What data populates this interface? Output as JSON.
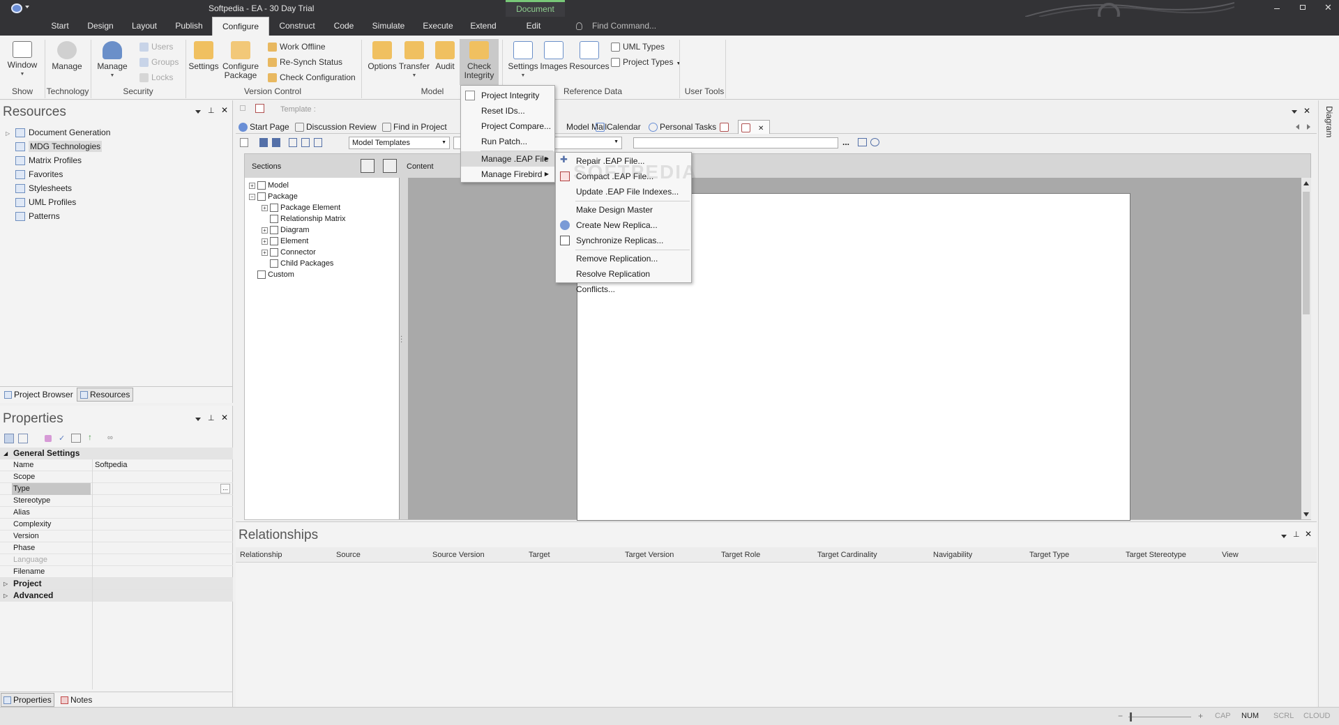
{
  "title": "Softpedia - EA - 30 Day Trial",
  "context_tab": {
    "group": "Document",
    "label": "Edit"
  },
  "tabs": [
    "Start",
    "Design",
    "Layout",
    "Publish",
    "Configure",
    "Construct",
    "Code",
    "Simulate",
    "Execute",
    "Extend"
  ],
  "find_command": "Find Command...",
  "ribbon": {
    "window": "Window",
    "manage_tech": "Manage",
    "manage_sec": "Manage",
    "users": "Users",
    "groups": "Groups",
    "locks": "Locks",
    "settings_vc": "Settings",
    "configure_package": "Configure Package",
    "work_offline": "Work Offline",
    "resynch": "Re-Synch Status",
    "check_config": "Check Configuration",
    "options": "Options",
    "transfer": "Transfer",
    "audit": "Audit",
    "check_integrity": "Check Integrity",
    "settings_ref": "Settings",
    "images": "Images",
    "resources": "Resources",
    "uml_types": "UML Types",
    "project_types": "Project Types",
    "groups_labels": {
      "show": "Show",
      "technology": "Technology",
      "security": "Security",
      "version_control": "Version Control",
      "model": "Model",
      "reference_data": "Reference Data",
      "user_tools": "User Tools"
    }
  },
  "resources_panel": {
    "title": "Resources",
    "items": [
      "Document Generation",
      "MDG Technologies",
      "Matrix Profiles",
      "Favorites",
      "Stylesheets",
      "UML Profiles",
      "Patterns"
    ],
    "tabs": [
      "Project Browser",
      "Resources"
    ]
  },
  "properties_panel": {
    "title": "Properties",
    "section": "General Settings",
    "rows": [
      {
        "k": "Name",
        "v": "Softpedia"
      },
      {
        "k": "Scope",
        "v": ""
      },
      {
        "k": "Type",
        "v": ""
      },
      {
        "k": "Stereotype",
        "v": ""
      },
      {
        "k": "Alias",
        "v": ""
      },
      {
        "k": "Complexity",
        "v": ""
      },
      {
        "k": "Version",
        "v": ""
      },
      {
        "k": "Phase",
        "v": ""
      },
      {
        "k": "Language",
        "v": ""
      },
      {
        "k": "Filename",
        "v": ""
      }
    ],
    "sections_after": [
      "Project",
      "Advanced"
    ],
    "tabs": [
      "Properties",
      "Notes"
    ]
  },
  "document": {
    "template_label": "Template :",
    "tabs": [
      "Start Page",
      "Discussion Review",
      "Find in Project",
      "Model Mail",
      "Calendar",
      "Personal Tasks"
    ],
    "templates_select": "Model Templates",
    "sections_label": "Sections",
    "content_label": "Content",
    "tree": [
      {
        "label": "Model",
        "level": 0,
        "exp": "+"
      },
      {
        "label": "Package",
        "level": 0,
        "exp": "-"
      },
      {
        "label": "Package Element",
        "level": 1,
        "exp": "+"
      },
      {
        "label": "Relationship Matrix",
        "level": 1,
        "exp": ""
      },
      {
        "label": "Diagram",
        "level": 1,
        "exp": "+"
      },
      {
        "label": "Element",
        "level": 1,
        "exp": "+"
      },
      {
        "label": "Connector",
        "level": 1,
        "exp": "+"
      },
      {
        "label": "Child Packages",
        "level": 1,
        "exp": ""
      },
      {
        "label": "Custom",
        "level": 0,
        "exp": ""
      }
    ],
    "dots": "..."
  },
  "relationships_panel": {
    "title": "Relationships",
    "columns": [
      "Relationship",
      "Source",
      "Source Version",
      "Target",
      "Target Version",
      "Target Role",
      "Target Cardinality",
      "Navigability",
      "Target Type",
      "Target Stereotype",
      "View"
    ]
  },
  "right_sidebar": "Diagram",
  "check_integrity_menu": [
    "Project Integrity",
    "Reset IDs...",
    "Project Compare...",
    "Run Patch...",
    "Manage .EAP File",
    "Manage Firebird"
  ],
  "eap_submenu": [
    "Repair .EAP File...",
    "Compact .EAP File...",
    "Update .EAP File Indexes...",
    "Make Design Master",
    "Create New Replica...",
    "Synchronize Replicas...",
    "Remove Replication...",
    "Resolve Replication Conflicts..."
  ],
  "watermark": "SOFTPEDIA",
  "status": {
    "minus": "−",
    "plus": "+",
    "cap": "CAP",
    "num": "NUM",
    "scrl": "SCRL",
    "cloud": "CLOUD"
  },
  "colors": {
    "chrome": "#333336",
    "accent": "#78c878",
    "panel": "#f3f3f3"
  }
}
